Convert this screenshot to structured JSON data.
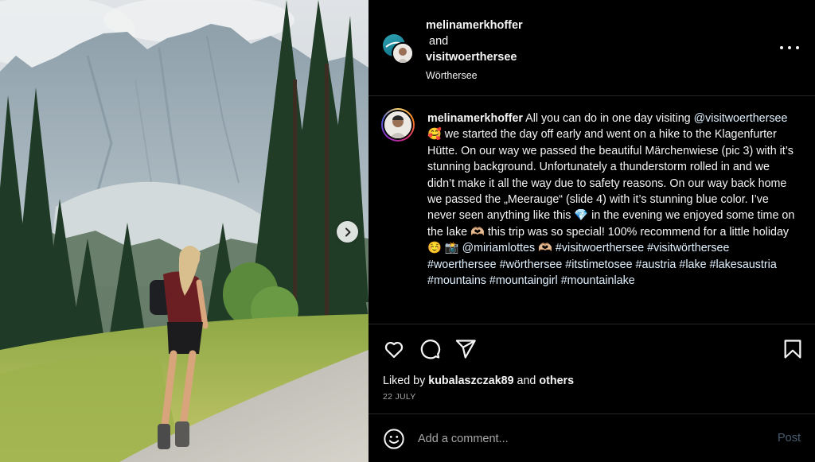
{
  "post": {
    "header": {
      "author_primary": "melinamerkhoffer",
      "and_text": "and",
      "author_secondary": "visitwoerthersee",
      "location": "Wörthersee"
    },
    "caption": {
      "username": "melinamerkhoffer",
      "segments": [
        "All you can do in one day visiting",
        "@visitwoerthersee",
        "🥰 we started the day off early and went on a hike to the Klagenfurter Hütte. On our way we passed the beautiful Märchenwiese (pic 3) with it’s stunning background. Unfortunately a thunderstorm rolled in and we didn’t make it all the way due to safety reasons. On our way back home we passed the „Meerauge“ (slide 4) with it’s stunning blue color. I’ve never seen anything like this 💎 in the evening we enjoyed some time on the lake 🫶🏼 this trip was so special! 100% recommend for a little holiday ☺️ 📸",
        "@miriamlottes",
        "🫶🏼",
        "#visitwoerthersee",
        "#visitwörthersee",
        "#woerthersee",
        "#wörthersee",
        "#itstimetosee",
        "#austria",
        "#lake",
        "#lakesaustria",
        "#mountains",
        "#mountaingirl",
        "#mountainlake"
      ]
    },
    "likes": {
      "prefix": "Liked by",
      "user": "kubalaszczak89",
      "and": "and",
      "others": "others"
    },
    "date": "22 JULY",
    "comment": {
      "placeholder": "Add a comment...",
      "post_label": "Post"
    },
    "icons": {
      "like": "heart-icon",
      "comment": "comment-icon",
      "share": "share-icon",
      "save": "bookmark-icon",
      "more": "more-options-icon",
      "emoji": "emoji-icon",
      "next": "chevron-right-icon"
    },
    "colors": {
      "background": "#000000",
      "text": "#f5f5f5",
      "muted": "#a8a8a8",
      "divider": "#262626",
      "post_button": "#4a5d70",
      "mention": "#e0f1ff"
    }
  }
}
